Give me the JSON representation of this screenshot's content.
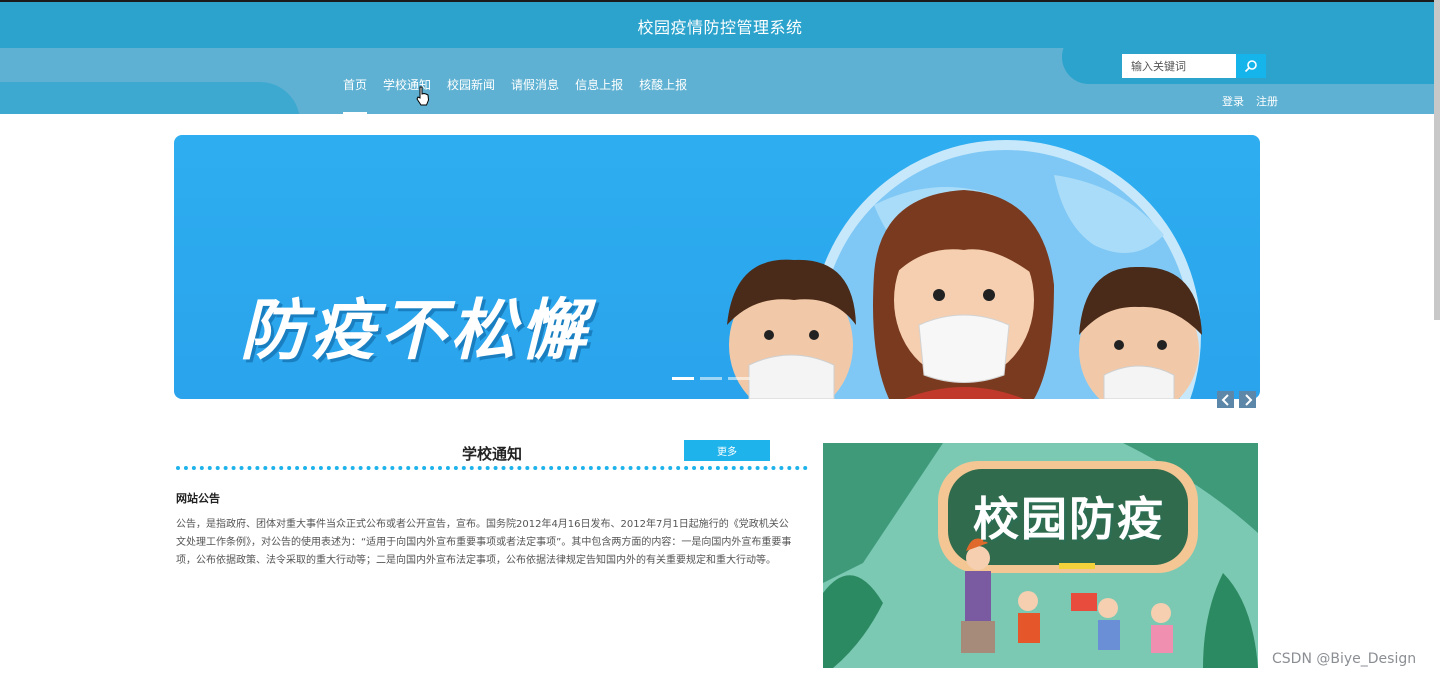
{
  "header": {
    "title": "校园疫情防控管理系统",
    "nav": [
      {
        "label": "首页",
        "active": true
      },
      {
        "label": "学校通知",
        "active": false
      },
      {
        "label": "校园新闻",
        "active": false
      },
      {
        "label": "请假消息",
        "active": false
      },
      {
        "label": "信息上报",
        "active": false
      },
      {
        "label": "核酸上报",
        "active": false
      }
    ],
    "search_placeholder": "输入关键词",
    "login": "登录",
    "register": "注册"
  },
  "banner": {
    "slogan": "防疫不松懈",
    "slide_count": 3,
    "active_slide": 1
  },
  "notice": {
    "title": "学校通知",
    "more": "更多",
    "article_title": "网站公告",
    "article_body": "公告，是指政府、团体对重大事件当众正式公布或者公开宣告，宣布。国务院2012年4月16日发布、2012年7月1日起施行的《党政机关公文处理工作条例》，对公告的使用表述为：“适用于向国内外宣布重要事项或者法定事项”。其中包含两方面的内容：一是向国内外宣布重要事项，公布依据政策、法令采取的重大行动等；二是向国内外宣布法定事项，公布依据法律规定告知国内外的有关重要规定和重大行动等。"
  },
  "side_image": {
    "caption": "校园防疫"
  },
  "watermark": "CSDN @Biye_Design",
  "colors": {
    "header_top": "#2ba3cc",
    "header_bottom": "#5eb1d2",
    "accent": "#1eb3ea"
  }
}
